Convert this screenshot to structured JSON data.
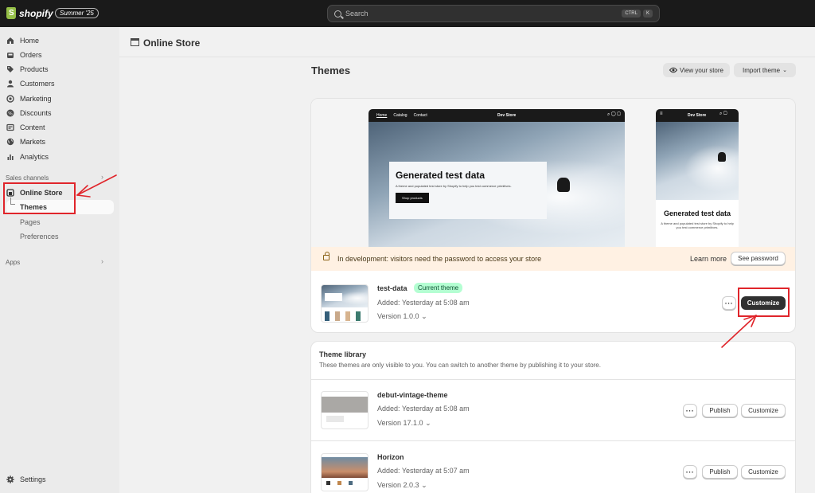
{
  "topbar": {
    "logo": "shopify",
    "badge": "Summer '25",
    "search_placeholder": "Search",
    "kbd_ctrl": "CTRL",
    "kbd_k": "K"
  },
  "sidebar": {
    "items": [
      {
        "label": "Home",
        "icon": "home-icon"
      },
      {
        "label": "Orders",
        "icon": "orders-icon"
      },
      {
        "label": "Products",
        "icon": "tag-icon"
      },
      {
        "label": "Customers",
        "icon": "person-icon"
      },
      {
        "label": "Marketing",
        "icon": "target-icon"
      },
      {
        "label": "Discounts",
        "icon": "discount-icon"
      },
      {
        "label": "Content",
        "icon": "content-icon"
      },
      {
        "label": "Markets",
        "icon": "globe-icon"
      },
      {
        "label": "Analytics",
        "icon": "chart-icon"
      }
    ],
    "sales_channels": "Sales channels",
    "online_store": "Online Store",
    "sub_items": [
      "Themes",
      "Pages",
      "Preferences"
    ],
    "apps": "Apps",
    "settings": "Settings"
  },
  "header": {
    "title": "Online Store"
  },
  "themes_page": {
    "title": "Themes",
    "view_store": "View your store",
    "import_theme": "Import theme"
  },
  "preview": {
    "nav_links": [
      "Home",
      "Catalog",
      "Contact"
    ],
    "brand": "Dev Store",
    "hero_title": "Generated test data",
    "hero_sub": "A theme and populated test store by Shopify to help you test commerce primitives.",
    "hero_button": "Shop products",
    "mobile_sub": "A theme and populated test store by Shopify to help you test commerce primitives."
  },
  "dev_banner": {
    "text": "In development: visitors need the password to access your store",
    "learn_more": "Learn more",
    "see_password": "See password"
  },
  "current_theme": {
    "name": "test-data",
    "badge": "Current theme",
    "added": "Added: Yesterday at 5:08 am",
    "version": "Version 1.0.0",
    "customize": "Customize"
  },
  "library": {
    "title": "Theme library",
    "subtitle": "These themes are only visible to you. You can switch to another theme by publishing it to your store.",
    "themes": [
      {
        "name": "debut-vintage-theme",
        "added": "Added: Yesterday at 5:08 am",
        "version": "Version 17.1.0",
        "publish": "Publish",
        "customize": "Customize"
      },
      {
        "name": "Horizon",
        "added": "Added: Yesterday at 5:07 am",
        "version": "Version 2.0.3",
        "publish": "Publish",
        "customize": "Customize"
      }
    ]
  },
  "colors": {
    "topbar": "#1a1a1a",
    "accent_green": "#95bf47",
    "annotation_red": "#e0252b",
    "banner": "#fff1e3"
  }
}
